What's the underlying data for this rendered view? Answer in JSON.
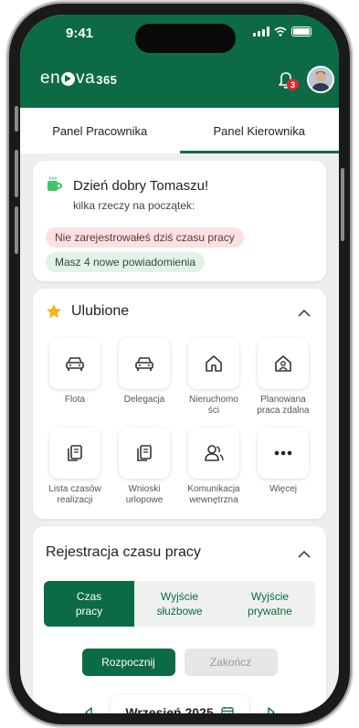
{
  "status_bar": {
    "time": "9:41"
  },
  "brand": {
    "name_part1": "en",
    "name_part2": "va",
    "suffix": "365"
  },
  "notifications": {
    "badge_count": "3"
  },
  "tabs": [
    {
      "label": "Panel Pracownika",
      "active": false
    },
    {
      "label": "Panel Kierownika",
      "active": true
    }
  ],
  "greeting": {
    "title": "Dzień dobry Tomaszu!",
    "subtitle": "kilka rzeczy na początek:",
    "alert_warning": "Nie zarejestrowałeś dziś czasu pracy",
    "alert_info": "Masz 4 nowe powiadomienia"
  },
  "favorites": {
    "title": "Ulubione",
    "items": [
      {
        "label": "Flota",
        "icon": "car-icon"
      },
      {
        "label": "Delegacja",
        "icon": "car-icon"
      },
      {
        "label": "Nieruchomo\nści",
        "icon": "house-icon"
      },
      {
        "label": "Planowana\npraca zdalna",
        "icon": "remote-house-icon"
      },
      {
        "label": "Lista czasów\nrealizacji",
        "icon": "documents-icon"
      },
      {
        "label": "Wnioski\nurlopowe",
        "icon": "documents-icon"
      },
      {
        "label": "Komunikacja\nwewnętrzna",
        "icon": "people-icon"
      },
      {
        "label": "Więcej",
        "icon": "more-icon"
      }
    ]
  },
  "time_registration": {
    "title": "Rejestracja czasu pracy",
    "segments": [
      {
        "label": "Czas\npracy",
        "active": true
      },
      {
        "label": "Wyjście\nsłużbowe",
        "active": false
      },
      {
        "label": "Wyjście\nprywatne",
        "active": false
      }
    ],
    "start_label": "Rozpocznij",
    "end_label": "Zakończ",
    "month": "Wrzesień 2025"
  },
  "colors": {
    "brand_green": "#0c6b45",
    "alert_red_bg": "#fbe1e1",
    "alert_green_bg": "#e1f3e6",
    "badge_red": "#e0262e",
    "star": "#f2b21a"
  }
}
